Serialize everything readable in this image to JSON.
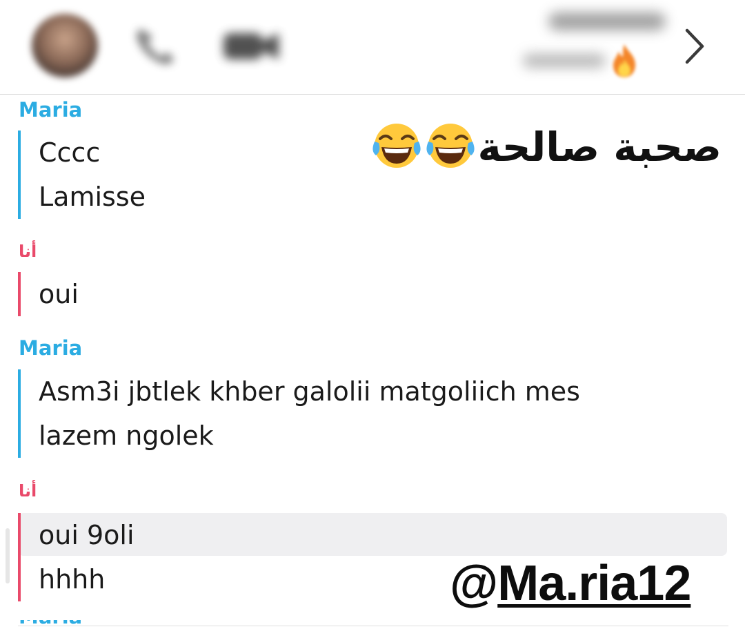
{
  "header": {
    "avatar_icon": "profile-avatar",
    "call_icon": "phone-icon",
    "video_icon": "video-icon",
    "streak_icon": "fire-emoji-icon",
    "next_icon": "chevron-right-icon"
  },
  "messages": [
    {
      "sender": "Maria",
      "role": "friend",
      "lines": [
        "Cccc",
        "Lamisse"
      ]
    },
    {
      "sender": "أنا",
      "role": "me",
      "lines": [
        "oui"
      ]
    },
    {
      "sender": "Maria",
      "role": "friend",
      "lines": [
        "Asm3i jbtlek khber galolii matgoliich mes",
        "lazem ngolek"
      ]
    },
    {
      "sender": "أنا",
      "role": "me",
      "lines": [
        "oui 9oli",
        "hhhh"
      ]
    }
  ],
  "overlay": {
    "caption": "صحبة صالحة",
    "emoji": "face-with-tears-of-joy-emoji",
    "watermark_at": "@",
    "watermark_name": "Ma.ria12"
  },
  "colors": {
    "friend": "#2bace2",
    "me": "#e94a6a",
    "highlight": "#efeff1"
  }
}
